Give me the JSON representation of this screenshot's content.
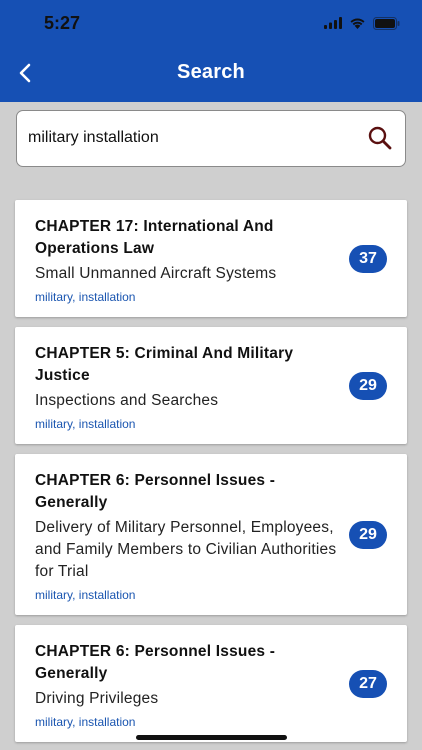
{
  "status": {
    "time": "5:27"
  },
  "header": {
    "title": "Search"
  },
  "search": {
    "value": "military installation"
  },
  "results": [
    {
      "title": "CHAPTER 17: International And Operations Law",
      "subtitle": "Small Unmanned Aircraft Systems",
      "tags": "military, installation",
      "count": "37"
    },
    {
      "title": "CHAPTER 5: Criminal And Military Justice",
      "subtitle": "Inspections and Searches",
      "tags": "military, installation",
      "count": "29"
    },
    {
      "title": "CHAPTER 6: Personnel Issues - Generally",
      "subtitle": "Delivery of Military Personnel, Employees, and Family Members to Civilian Authorities for Trial",
      "tags": "military, installation",
      "count": "29"
    },
    {
      "title": "CHAPTER 6: Personnel Issues - Generally",
      "subtitle": "Driving Privileges",
      "tags": "military, installation",
      "count": "27"
    }
  ],
  "colors": {
    "brand": "#1650b4",
    "background": "#cfcfcf",
    "tag": "#1a55b0"
  },
  "icons": {
    "back": "chevron-left-icon",
    "search": "search-icon",
    "signal": "signal-icon",
    "wifi": "wifi-icon",
    "battery": "battery-icon"
  }
}
